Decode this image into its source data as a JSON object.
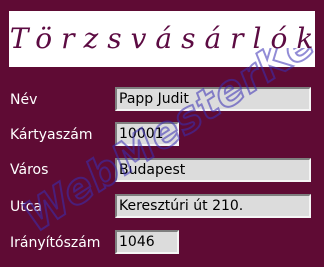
{
  "form": {
    "title": "Törzsvásárlók",
    "fields": [
      {
        "label": "Név",
        "value": "Papp Judit"
      },
      {
        "label": "Kártyaszám",
        "value": "10001"
      },
      {
        "label": "Város",
        "value": "Budapest"
      },
      {
        "label": "Utca",
        "value": "Keresztúri út 210."
      },
      {
        "label": "Irányítószám",
        "value": "1046"
      }
    ]
  },
  "watermark": {
    "text": "WebMesterKé"
  },
  "colors": {
    "background": "#5f0b34",
    "title_text": "#5c0b42",
    "field_bg": "#dcdcdc",
    "watermark": "#3a2fb5"
  }
}
